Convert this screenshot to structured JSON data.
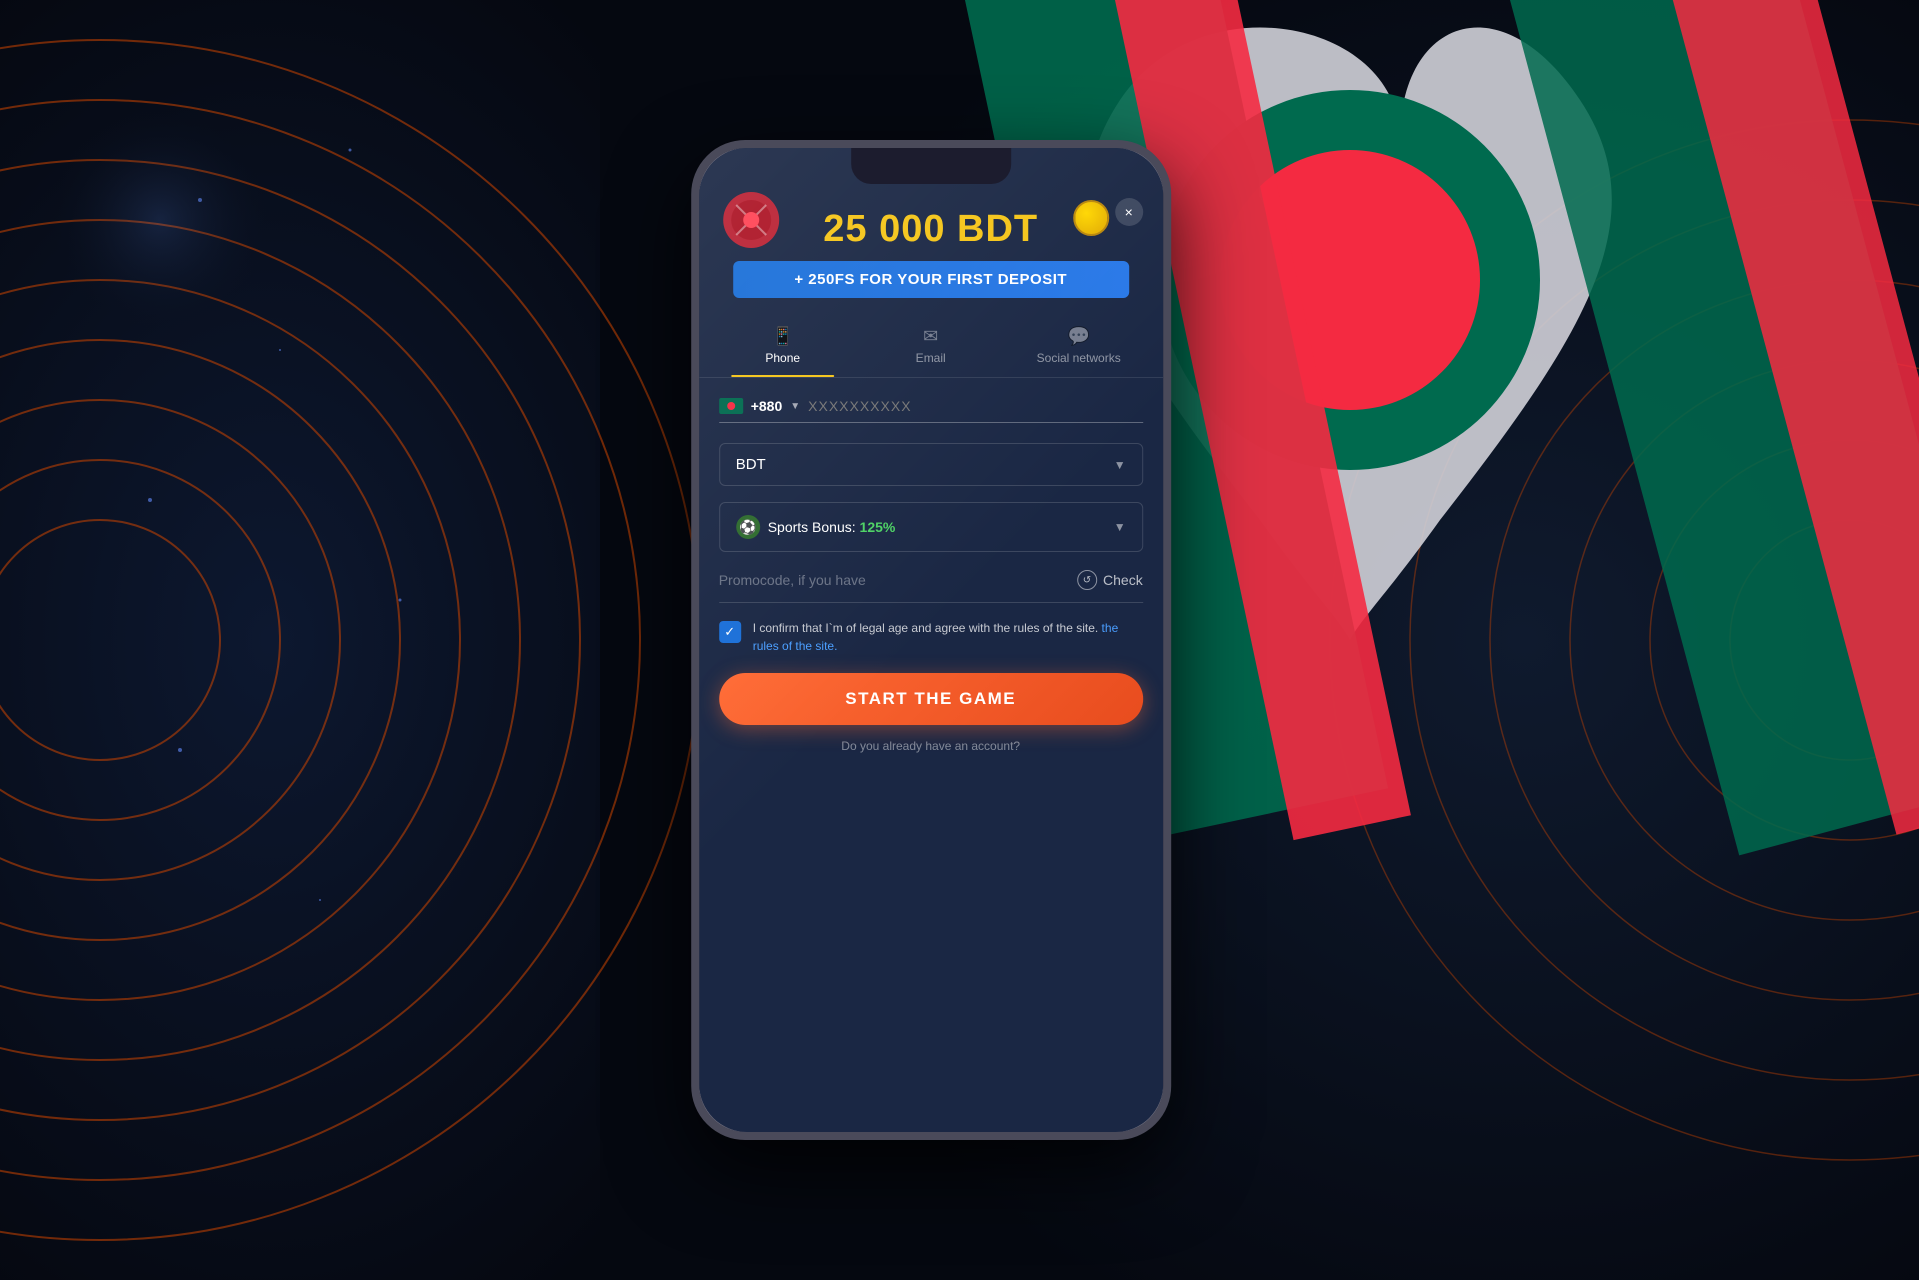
{
  "background": {
    "color": "#0a0e1a",
    "accent_color": "#e85c00"
  },
  "phone": {
    "bonus_amount": "25 000 BDT",
    "bonus_banner": "+ 250FS FOR YOUR FIRST DEPOSIT",
    "close_label": "×",
    "tabs": [
      {
        "id": "phone",
        "label": "Phone",
        "active": true
      },
      {
        "id": "email",
        "label": "Email",
        "active": false
      },
      {
        "id": "social",
        "label": "Social networks",
        "active": false
      }
    ],
    "form": {
      "country_code": "+880",
      "phone_placeholder": "XXXXXXXXXX",
      "currency": "BDT",
      "bonus_label": "Sports Bonus:",
      "bonus_percent": "125%",
      "promo_placeholder": "Promocode, if you have",
      "check_label": "Check",
      "agree_text": "I confirm that I`m of legal age and agree with the rules of the site.",
      "agree_link": "the rules of the site.",
      "start_button": "START THE GAME",
      "bottom_text": "Do you already have an account?"
    }
  }
}
